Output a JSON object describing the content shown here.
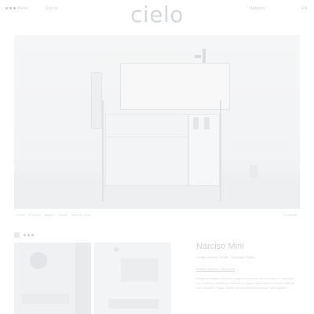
{
  "header": {
    "menu_label": "Menu",
    "search_label": "Cerca",
    "logo": "cielo",
    "lang_label": "Italiano",
    "right_label": "EN"
  },
  "breadcrumb": [
    "Home",
    "Prodotti",
    "Bagno",
    "Mobili",
    "Narciso Mini"
  ],
  "share_label": "Condividi",
  "product": {
    "name": "Narciso Mini",
    "designer": "Design: Andrea Parisio · Giuseppe Parisio",
    "note": "Scheda tecnica e download",
    "description": "Elegante sistema di arredo bagno composto da un lavabo in ceramica con struttura metallica e frontale in legno. Disponibile in diverse finiture, con cassetti e ripiani aperti per un utilizzo funzionale dello spazio."
  },
  "colors": {
    "background": "#ffffff",
    "text": "#c9ccd0"
  }
}
